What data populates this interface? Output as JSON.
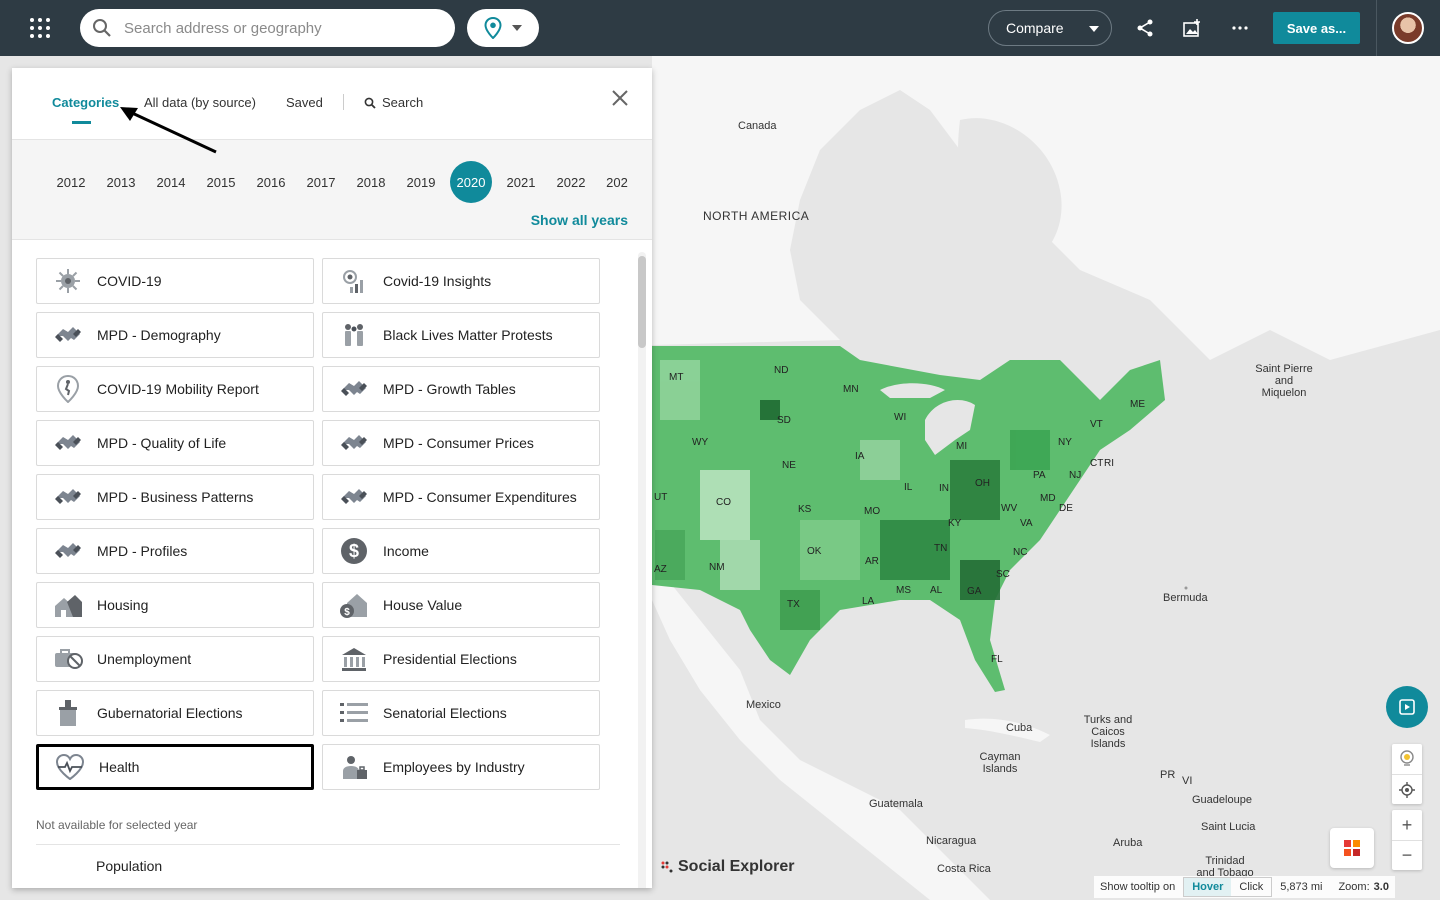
{
  "search": {
    "placeholder": "Search address or geography"
  },
  "toolbar": {
    "compare_label": "Compare",
    "save_label": "Save as..."
  },
  "tabs": [
    {
      "label": "Categories"
    },
    {
      "label": "All data (by source)"
    },
    {
      "label": "Saved"
    },
    {
      "label": "Search"
    }
  ],
  "years": [
    "2012",
    "2013",
    "2014",
    "2015",
    "2016",
    "2017",
    "2018",
    "2019",
    "2020",
    "2021",
    "2022",
    "202"
  ],
  "selected_year": "2020",
  "show_all_years": "Show all years",
  "categories": [
    {
      "label": "COVID-19",
      "icon": "virus-icon"
    },
    {
      "label": "Covid-19 Insights",
      "icon": "covid-insights-icon"
    },
    {
      "label": "MPD - Demography",
      "icon": "handshake-icon"
    },
    {
      "label": "Black Lives Matter Protests",
      "icon": "people-icon"
    },
    {
      "label": "COVID-19 Mobility Report",
      "icon": "mobility-pin-icon"
    },
    {
      "label": "MPD - Growth Tables",
      "icon": "handshake-icon"
    },
    {
      "label": "MPD - Quality of Life",
      "icon": "handshake-icon"
    },
    {
      "label": "MPD - Consumer Prices",
      "icon": "handshake-icon"
    },
    {
      "label": "MPD - Business Patterns",
      "icon": "handshake-icon"
    },
    {
      "label": "MPD - Consumer Expenditures",
      "icon": "handshake-icon"
    },
    {
      "label": "MPD - Profiles",
      "icon": "handshake-icon"
    },
    {
      "label": "Income",
      "icon": "dollar-icon"
    },
    {
      "label": "Housing",
      "icon": "houses-icon"
    },
    {
      "label": "House Value",
      "icon": "house-value-icon"
    },
    {
      "label": "Unemployment",
      "icon": "unemployment-icon"
    },
    {
      "label": "Presidential Elections",
      "icon": "capitol-icon"
    },
    {
      "label": "Gubernatorial Elections",
      "icon": "ballot-box-icon"
    },
    {
      "label": "Senatorial Elections",
      "icon": "list-icon"
    },
    {
      "label": "Health",
      "icon": "heart-pulse-icon"
    },
    {
      "label": "Employees by Industry",
      "icon": "worker-icon"
    }
  ],
  "not_available": "Not available for selected year",
  "unavailable_items": [
    "Population"
  ],
  "map": {
    "labels": [
      "Canada",
      "NORTH AMERICA",
      "Saint Pierre and Miquelon",
      "Bermuda",
      "Mexico",
      "Cuba",
      "Turks and Caicos Islands",
      "Cayman Islands",
      "PR",
      "VI",
      "Guadeloupe",
      "Saint Lucia",
      "Guatemala",
      "Nicaragua",
      "Costa Rica",
      "Aruba",
      "Trinidad and Tobago"
    ],
    "states": [
      "MT",
      "ND",
      "MN",
      "SD",
      "WI",
      "WY",
      "NE",
      "IA",
      "MI",
      "CO",
      "KS",
      "MO",
      "IL",
      "IN",
      "OH",
      "PA",
      "NY",
      "VT",
      "ME",
      "CT",
      "RI",
      "NJ",
      "MD",
      "DE",
      "WV",
      "VA",
      "KY",
      "TN",
      "NC",
      "OK",
      "AR",
      "MS",
      "AL",
      "GA",
      "SC",
      "TX",
      "LA",
      "FL",
      "NM",
      "AZ",
      "UT"
    ],
    "brand": "Social Explorer"
  },
  "footer": {
    "tooltip_label": "Show tooltip on",
    "hover": "Hover",
    "click": "Click",
    "scale": "5,873 mi",
    "zoom_label": "Zoom:",
    "zoom_value": "3.0"
  },
  "colors": {
    "accent": "#108a9b",
    "topbar": "#2e3b44"
  }
}
